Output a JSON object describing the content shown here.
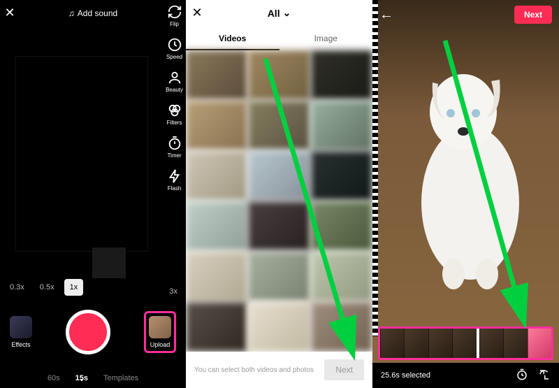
{
  "panel1": {
    "add_sound": "Add sound",
    "tools": {
      "flip": "Flip",
      "speed": "Speed",
      "beauty": "Beauty",
      "filters": "Filters",
      "timer": "Timer",
      "flash": "Flash"
    },
    "zoom": {
      "x03": "0.3x",
      "x05": "0.5x",
      "x1": "1x",
      "x3": "3x"
    },
    "effects_label": "Effects",
    "upload_label": "Upload",
    "tabs": {
      "sixty": "60s",
      "fifteen": "15s",
      "templates": "Templates"
    }
  },
  "panel2": {
    "title": "All",
    "tabs": {
      "videos": "Videos",
      "image": "Image"
    },
    "hint": "You can select both videos and photos",
    "next": "Next"
  },
  "panel3": {
    "next": "Next",
    "selected": "25.6s selected"
  }
}
